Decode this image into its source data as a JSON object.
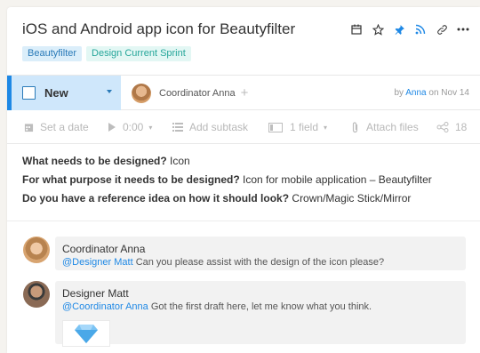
{
  "task": {
    "title": "iOS and Android app icon for Beautyfilter",
    "tags": [
      "Beautyfilter",
      "Design Current Sprint"
    ]
  },
  "status": {
    "label": "New",
    "assignee": "Coordinator Anna",
    "byline_prefix": "by",
    "byline_author": "Anna",
    "byline_suffix": "on Nov 14"
  },
  "toolbar": {
    "set_date": "Set a date",
    "timer": "0:00",
    "add_subtask": "Add subtask",
    "field": "1 field",
    "attach": "Attach files",
    "share_count": "18"
  },
  "description": [
    {
      "q": "What needs to be designed?",
      "a": " Icon"
    },
    {
      "q": "For what purpose it needs to be designed?",
      "a": " Icon for mobile application – Beautyfilter"
    },
    {
      "q": "Do you have a reference idea on how it should look?",
      "a": " Crown/Magic Stick/Mirror"
    }
  ],
  "comments": [
    {
      "author": "Coordinator Anna",
      "mention": "@Designer Matt",
      "text": " Can you please assist with the design of the icon please?"
    },
    {
      "author": "Designer Matt",
      "mention": "@Coordinator Anna",
      "text": " Got the first draft here, let me know what you think."
    }
  ],
  "colors": {
    "accent": "#1e88e5",
    "status_bg": "#cfe7fb",
    "tag_blue": "#2a7ab8",
    "tag_teal": "#26a69a"
  },
  "icons": [
    "calendar-icon",
    "star-icon",
    "pin-icon",
    "rss-icon",
    "link-icon",
    "more-icon"
  ]
}
